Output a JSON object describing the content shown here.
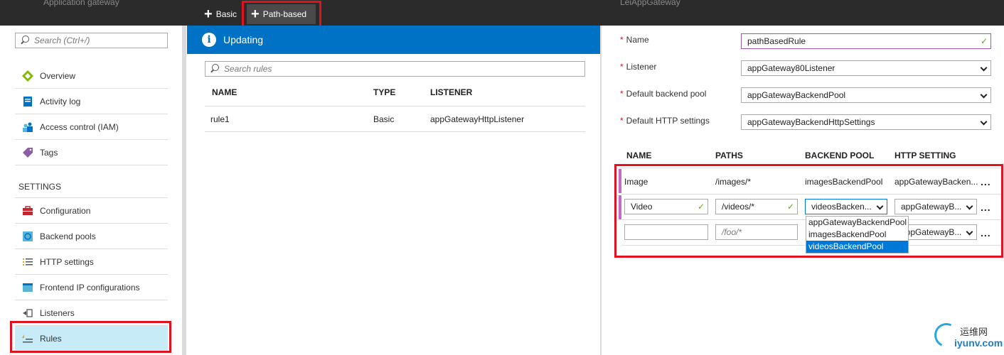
{
  "header": {
    "left_blade_title": "Application gateway",
    "right_blade_title": "LeiAppGateway",
    "commands": [
      {
        "label": "Basic"
      },
      {
        "label": "Path-based"
      }
    ]
  },
  "sidebar": {
    "search_placeholder": "Search (Ctrl+/)",
    "items": [
      {
        "label": "Overview",
        "icon": "overview-icon"
      },
      {
        "label": "Activity log",
        "icon": "activity-log-icon"
      },
      {
        "label": "Access control (IAM)",
        "icon": "iam-icon"
      },
      {
        "label": "Tags",
        "icon": "tag-icon"
      }
    ],
    "section_label": "SETTINGS",
    "settings_items": [
      {
        "label": "Configuration",
        "icon": "briefcase-icon"
      },
      {
        "label": "Backend pools",
        "icon": "backend-pool-icon"
      },
      {
        "label": "HTTP settings",
        "icon": "list-icon"
      },
      {
        "label": "Frontend IP configurations",
        "icon": "frontend-ip-icon"
      },
      {
        "label": "Listeners",
        "icon": "listener-icon"
      },
      {
        "label": "Rules",
        "icon": "rules-icon"
      }
    ]
  },
  "rules_blade": {
    "status": "Updating",
    "search_placeholder": "Search rules",
    "columns": [
      "NAME",
      "TYPE",
      "LISTENER"
    ],
    "rows": [
      {
        "name": "rule1",
        "type": "Basic",
        "listener": "appGatewayHttpListener"
      }
    ]
  },
  "rule_form": {
    "fields": [
      {
        "label": "Name",
        "value": "pathBasedRule"
      },
      {
        "label": "Listener",
        "value": "appGateway80Listener"
      },
      {
        "label": "Default backend pool",
        "value": "appGatewayBackendPool"
      },
      {
        "label": "Default HTTP settings",
        "value": "appGatewayBackendHttpSettings"
      }
    ],
    "path_columns": [
      "NAME",
      "PATHS",
      "BACKEND POOL",
      "HTTP SETTING"
    ],
    "path_rows": [
      {
        "name": "Image",
        "paths": "/images/*",
        "pool": "imagesBackendPool",
        "setting": "appGatewayBacken..."
      },
      {
        "name": "Video",
        "paths": "/videos/*",
        "pool": "videosBacken...",
        "setting": "appGatewayB..."
      },
      {
        "name": "",
        "paths_placeholder": "/foo/*",
        "setting": "appGatewayB..."
      }
    ],
    "ellipsis": "...",
    "dropdown_options": [
      "appGatewayBackendPool",
      "imagesBackendPool",
      "videosBackendPool"
    ]
  },
  "watermark": {
    "line1": "运维网",
    "line2": "iyunv.com"
  }
}
